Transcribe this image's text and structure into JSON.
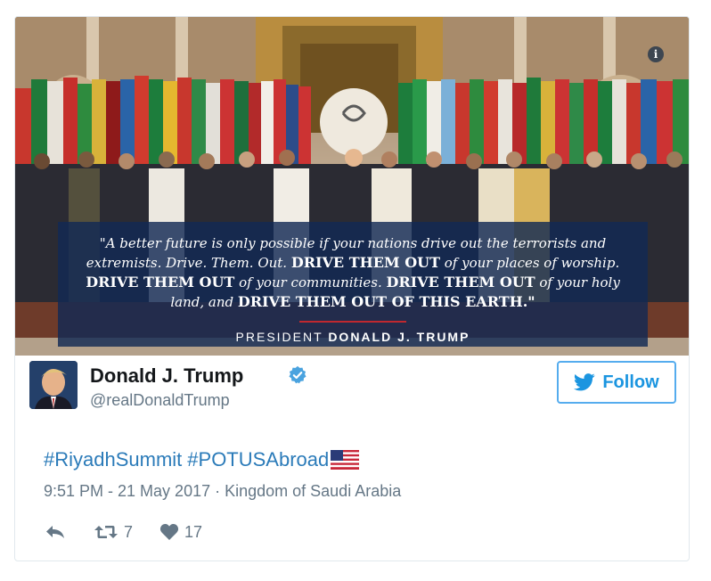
{
  "media": {
    "quote_lines": [
      {
        "text": "\"A better future is only possible if your nations drive out the terrorists and",
        "style": "regular"
      },
      {
        "text": "extremists. Drive. Them. Out. ",
        "style": "regular",
        "bold_tail": "DRIVE THEM OUT",
        "tail": " of your places of worship."
      },
      {
        "bold_head": "DRIVE THEM OUT",
        "text": " of your communities. ",
        "bold_tail": "DRIVE THEM OUT",
        "tail": " of your holy"
      },
      {
        "text": "land, and ",
        "bold_tail": "DRIVE THEM OUT OF THIS EARTH.\"",
        "tail": ""
      }
    ],
    "attribution_prefix": "PRESIDENT",
    "attribution_name": "DONALD J. TRUMP",
    "info_icon": "i"
  },
  "user": {
    "display_name": "Donald J. Trump",
    "handle": "@realDonaldTrump",
    "verified_icon": "verified-badge-icon"
  },
  "follow_button": {
    "label": "Follow"
  },
  "tweet": {
    "hashtags": [
      "#RiyadhSummit",
      "#POTUSAbroad"
    ],
    "flag_icon": "us-flag-icon"
  },
  "meta": {
    "timestamp": "9:51 PM - 21 May 2017 · Kingdom of Saudi Arabia"
  },
  "actions": {
    "retweet_count": "7",
    "like_count": "17"
  },
  "colors": {
    "accent": "#1b95e0",
    "hashtag": "#2b7bb9",
    "muted": "#657786",
    "quote_box": "#122954",
    "divider_red": "#c0282f"
  }
}
